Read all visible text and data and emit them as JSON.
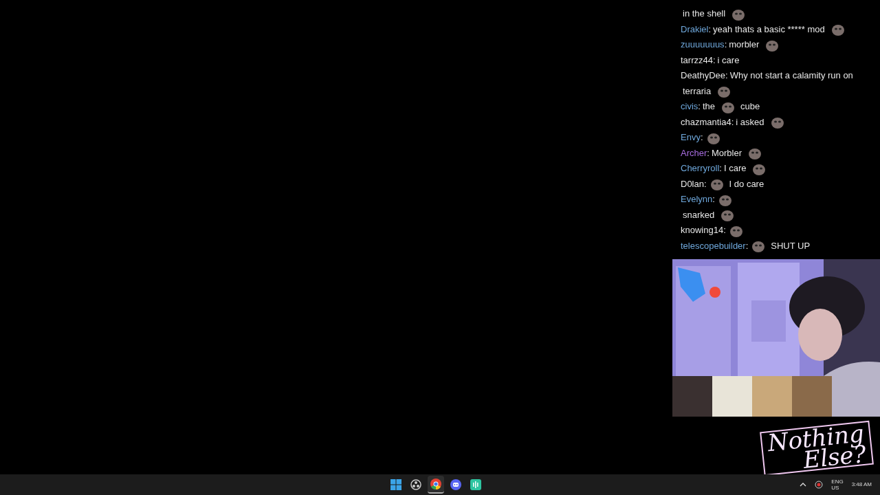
{
  "chat": {
    "messages": [
      {
        "parts": [
          {
            "kind": "text",
            "text": "in the shell"
          },
          {
            "kind": "emote"
          }
        ]
      },
      {
        "user": "Drakiel",
        "color": "#6fa8dc",
        "separator": ":",
        "parts": [
          {
            "kind": "text",
            "text": "yeah thats a basic ***** mod"
          },
          {
            "kind": "emote"
          }
        ]
      },
      {
        "user": "zuuuuuuus",
        "color": "#6fa8dc",
        "separator": ":",
        "parts": [
          {
            "kind": "text",
            "text": "morbler"
          },
          {
            "kind": "emote"
          }
        ]
      },
      {
        "user": "tarrzz44",
        "color": "#e8e8e8",
        "separator": ":",
        "parts": [
          {
            "kind": "text",
            "text": "i care"
          }
        ]
      },
      {
        "user": "DeathyDee",
        "color": "#e8e8e8",
        "separator": ":",
        "parts": [
          {
            "kind": "text",
            "text": "Why not start a calamity run on"
          },
          {
            "kind": "text",
            "text": "terraria"
          },
          {
            "kind": "emote"
          }
        ]
      },
      {
        "user": "civis",
        "color": "#6fa8dc",
        "separator": ":",
        "parts": [
          {
            "kind": "text",
            "text": "the"
          },
          {
            "kind": "emote"
          },
          {
            "kind": "text",
            "text": "cube"
          }
        ]
      },
      {
        "user": "chazmantia4",
        "color": "#e8e8e8",
        "separator": ":",
        "parts": [
          {
            "kind": "text",
            "text": "i asked"
          },
          {
            "kind": "emote"
          }
        ]
      },
      {
        "user": "Envy",
        "color": "#6fa8dc",
        "separator": ":",
        "parts": [
          {
            "kind": "emote"
          }
        ]
      },
      {
        "user": "Archer",
        "color": "#a86de0",
        "separator": ":",
        "parts": [
          {
            "kind": "text",
            "text": "Morbler"
          },
          {
            "kind": "emote"
          }
        ]
      },
      {
        "user": "Cherryroll",
        "color": "#6fa8dc",
        "separator": ":",
        "parts": [
          {
            "kind": "text",
            "text": "I care"
          },
          {
            "kind": "emote"
          }
        ]
      },
      {
        "user": "D0lan",
        "color": "#e8e8e8",
        "separator": ":",
        "parts": [
          {
            "kind": "emote"
          },
          {
            "kind": "text",
            "text": "I do care"
          }
        ]
      },
      {
        "user": "Evelynn",
        "color": "#6fa8dc",
        "separator": ":",
        "parts": [
          {
            "kind": "emote"
          }
        ]
      },
      {
        "parts": [
          {
            "kind": "text",
            "text": "snarked"
          },
          {
            "kind": "emote"
          }
        ]
      },
      {
        "user": "knowing14",
        "color": "#e8e8e8",
        "separator": ":",
        "parts": [
          {
            "kind": "emote"
          }
        ]
      },
      {
        "user": "telescopebuilder",
        "color": "#6fa8dc",
        "separator": ":",
        "parts": [
          {
            "kind": "emote"
          },
          {
            "kind": "text",
            "text": "SHUT UP"
          }
        ]
      }
    ]
  },
  "logo": {
    "lines": [
      "Nothing",
      "Else?"
    ]
  },
  "taskbar": {
    "apps": [
      {
        "kind": "start",
        "selected": false
      },
      {
        "kind": "ring",
        "selected": false
      },
      {
        "kind": "browser",
        "selected": true
      },
      {
        "kind": "chat",
        "selected": false
      },
      {
        "kind": "audio",
        "selected": false
      }
    ],
    "language": "ENG",
    "region": "US",
    "time": "3:48 AM"
  }
}
